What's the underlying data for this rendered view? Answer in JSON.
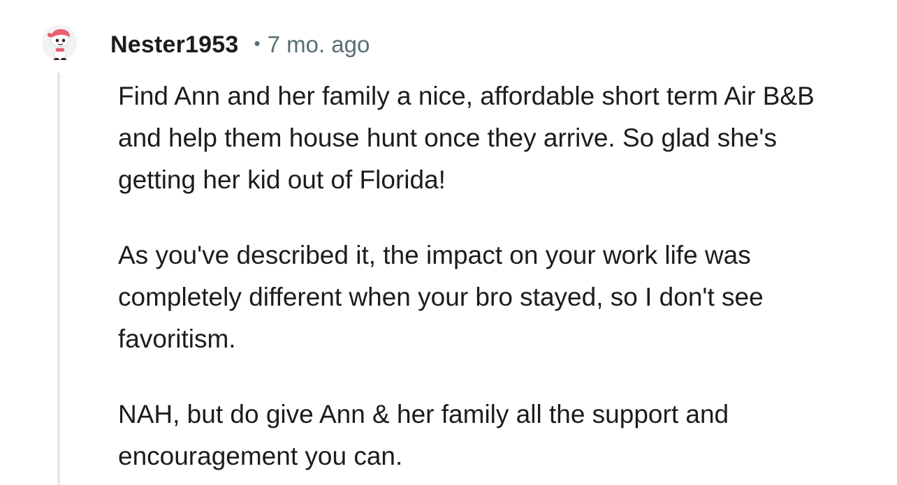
{
  "comment": {
    "author": "Nester1953",
    "separator": "•",
    "age": "7 mo. ago",
    "avatar_icon": "snoo-avatar-icon",
    "paragraphs": [
      "Find Ann and her family a nice, affordable short term Air B&B and help them house hunt once they arrive. So glad she's getting her kid out of Florida!",
      "As you've described it, the impact on your work life was completely different when your bro stayed, so I don't see favoritism.",
      "NAH, but do give Ann & her family all the support and encouragement you can."
    ]
  },
  "colors": {
    "text": "#1c1c1c",
    "meta": "#576f76",
    "thread_line": "#e6e8ea",
    "avatar_accent": "#e85f6f"
  }
}
